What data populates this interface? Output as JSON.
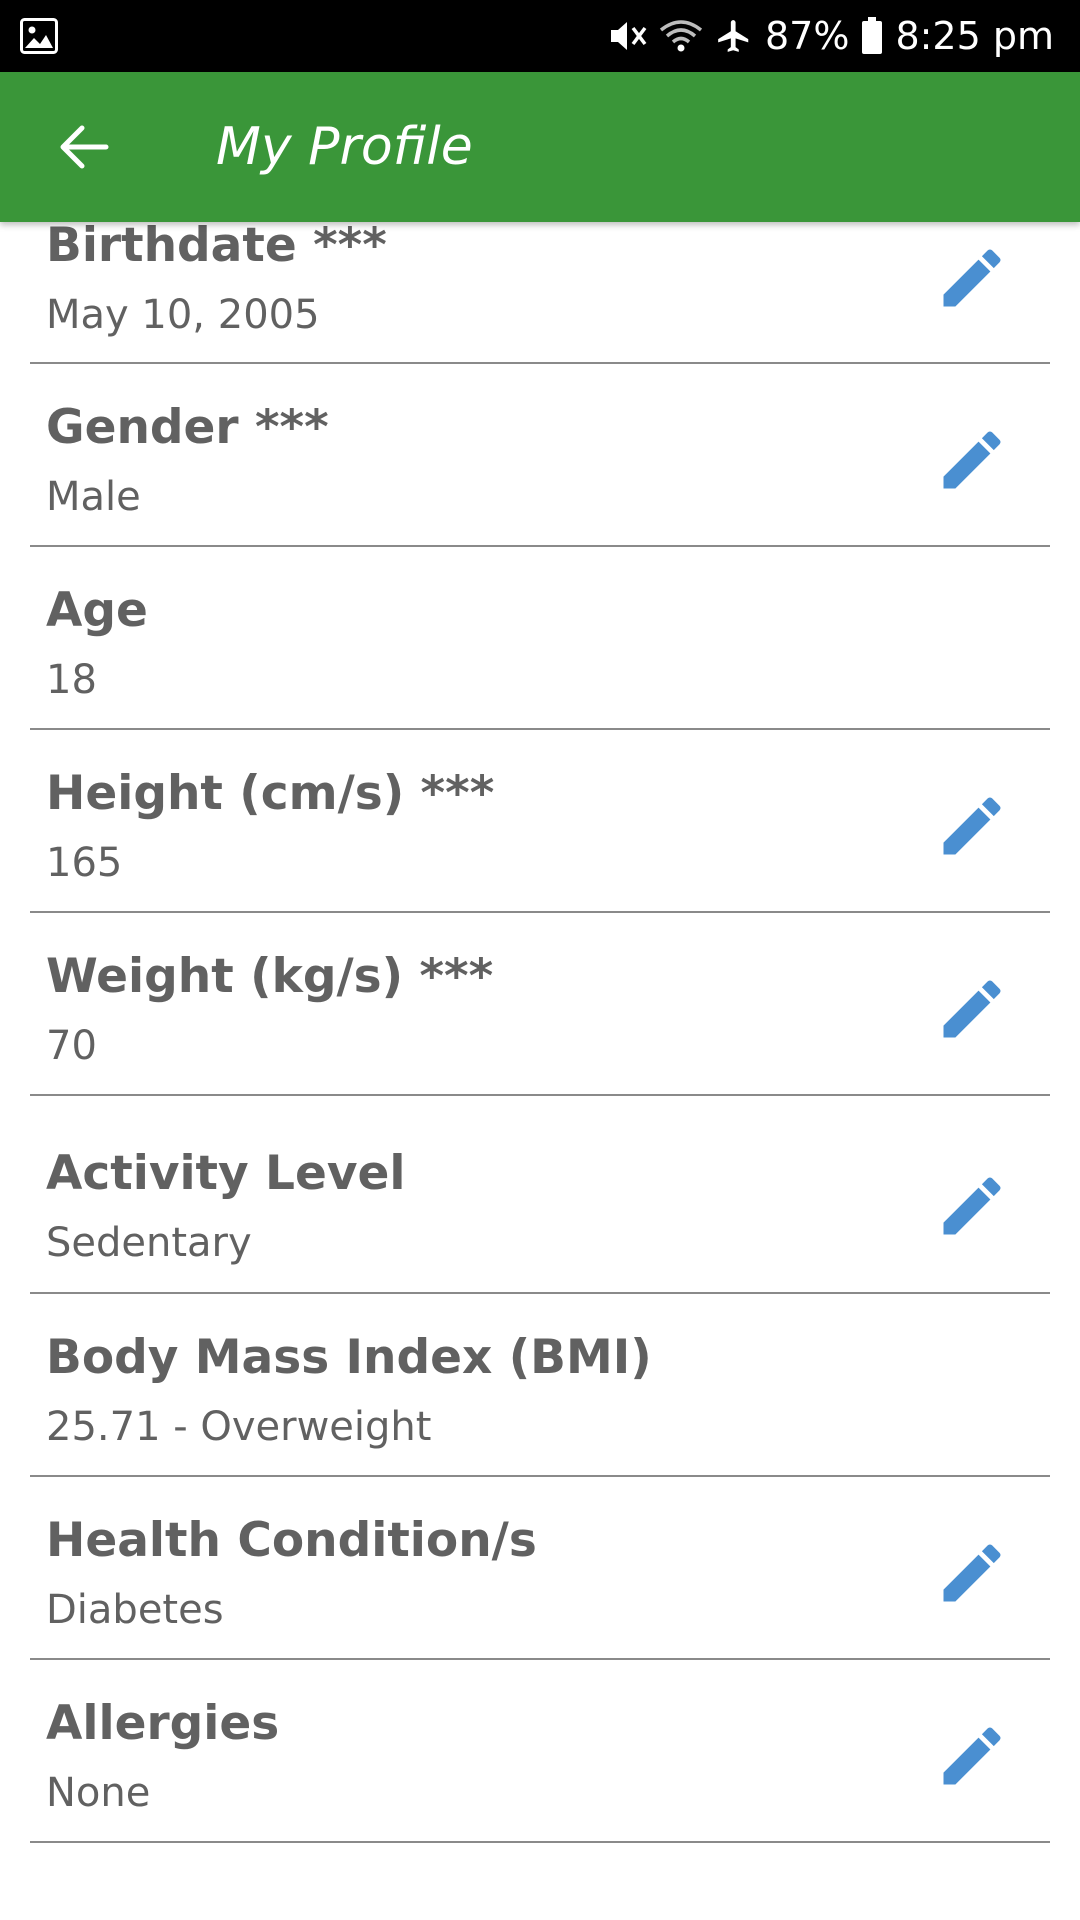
{
  "status_bar": {
    "battery": "87%",
    "time": "8:25 pm",
    "icons": [
      "image-icon",
      "mute-icon",
      "wifi-icon",
      "airplane-icon",
      "battery-icon"
    ]
  },
  "app_bar": {
    "title": "My Profile",
    "color": "#3a9639",
    "back_icon": "arrow-left-icon"
  },
  "profile_fields": [
    {
      "label": "Birthdate ***",
      "value": "May 10, 2005",
      "editable": true
    },
    {
      "label": "Gender ***",
      "value": "Male",
      "editable": true
    },
    {
      "label": "Age",
      "value": "18",
      "editable": false
    },
    {
      "label": "Height (cm/s) ***",
      "value": "165",
      "editable": true
    },
    {
      "label": "Weight (kg/s) ***",
      "value": "70",
      "editable": true
    },
    {
      "label": "Activity Level",
      "value": "Sedentary",
      "editable": true
    },
    {
      "label": "Body Mass Index (BMI)",
      "value": "25.71 - Overweight",
      "editable": false
    },
    {
      "label": "Health Condition/s",
      "value": "Diabetes",
      "editable": true
    },
    {
      "label": "Allergies",
      "value": "None",
      "editable": true
    }
  ],
  "edit_icon": "pencil-icon",
  "edit_icon_color": "#4a8fd1"
}
